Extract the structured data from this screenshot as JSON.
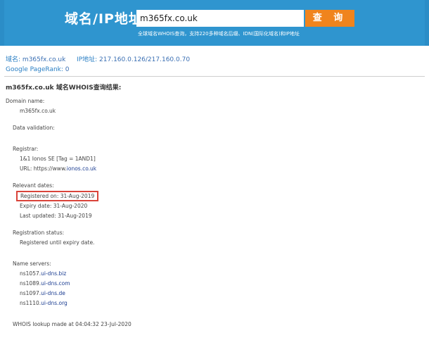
{
  "header": {
    "brand": "域名/IP地址:",
    "search_value": "m365fx.co.uk",
    "search_button": "查 询",
    "hint": "全球域名WHOIS查询，支持220多种域名后缀、IDN(国际化域名)和IP地址"
  },
  "info": {
    "domain_label": "域名:",
    "domain_value": "m365fx.co.uk",
    "ip_label": "IP地址:",
    "ip_value": "217.160.0.126/217.160.0.70",
    "pagerank_label": "Google PageRank:",
    "pagerank_value": "0"
  },
  "result_title": "m365fx.co.uk 域名WHOIS查询结果:",
  "whois": {
    "domain_name_label": "Domain name:",
    "domain_name_value": "m365fx.co.uk",
    "data_validation_label": "Data validation:",
    "registrar_label": "Registrar:",
    "registrar_name": "1&1 Ionos SE [Tag = 1AND1]",
    "registrar_url_prefix": "URL: https://www.",
    "registrar_url_link": "ionos.co.uk",
    "relevant_dates_label": "Relevant dates:",
    "registered_on": "Registered on: 31-Aug-2019",
    "expiry_date": "Expiry date:  31-Aug-2020",
    "last_updated": "Last updated:  31-Aug-2019",
    "registration_status_label": "Registration status:",
    "registration_status_value": "Registered until expiry date.",
    "name_servers_label": "Name servers:",
    "name_servers": [
      {
        "prefix": "ns1057.",
        "link": "ui-dns.biz"
      },
      {
        "prefix": "ns1089.",
        "link": "ui-dns.com"
      },
      {
        "prefix": "ns1097.",
        "link": "ui-dns.de"
      },
      {
        "prefix": "ns1110.",
        "link": "ui-dns.org"
      }
    ],
    "lookup_made": "WHOIS lookup made at 04:04:32 23-Jul-2020"
  },
  "colors": {
    "header_bg": "#2f95cf",
    "button_bg": "#f0841d",
    "link": "#1a3c91",
    "highlight_border": "#d9443a"
  }
}
